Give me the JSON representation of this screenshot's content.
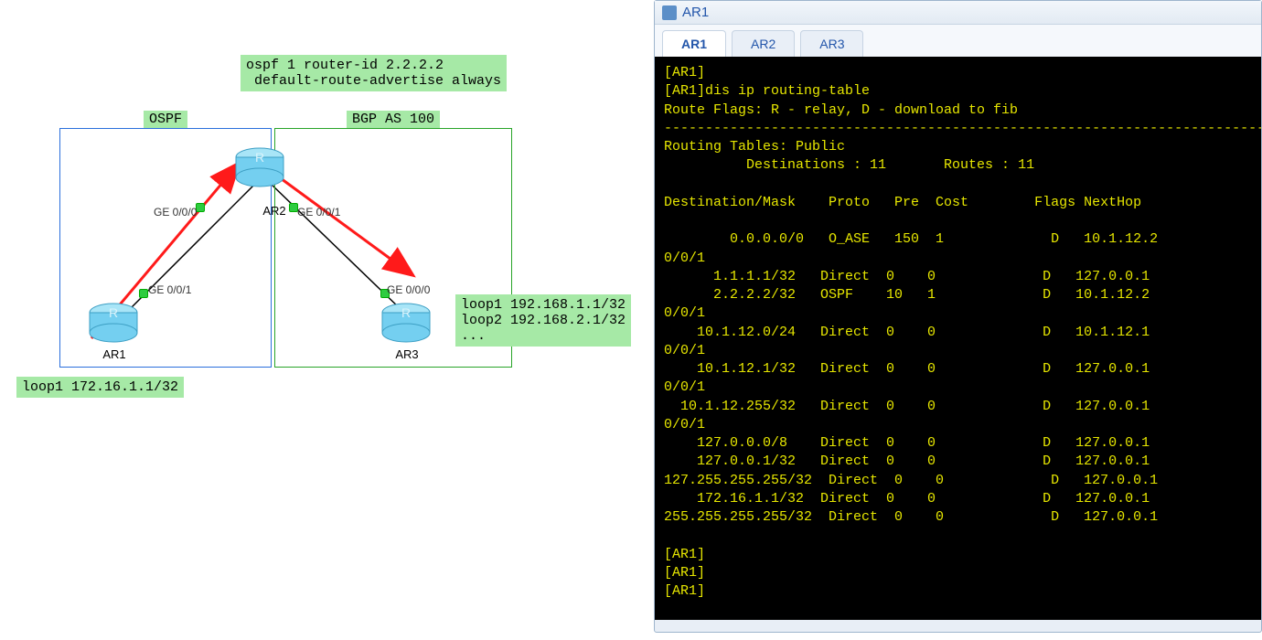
{
  "config_note": "ospf 1 router-id 2.2.2.2\n default-route-advertise always",
  "areas": {
    "ospf": {
      "label": "OSPF"
    },
    "bgp": {
      "label": "BGP AS 100"
    }
  },
  "routers": {
    "ar1": {
      "name": "AR1"
    },
    "ar2": {
      "name": "AR2"
    },
    "ar3": {
      "name": "AR3"
    }
  },
  "interfaces": {
    "ar1_ge001": "GE 0/0/1",
    "ar2_ge000": "GE 0/0/0",
    "ar2_ge001": "GE 0/0/1",
    "ar3_ge000": "GE 0/0/0"
  },
  "loopbacks": {
    "ar1": "loop1 172.16.1.1/32",
    "ar3": "loop1 192.168.1.1/32\nloop2 192.168.2.1/32\n..."
  },
  "terminal": {
    "title": "AR1",
    "tabs": [
      "AR1",
      "AR2",
      "AR3"
    ],
    "active_tab": 0,
    "prompt1": "[AR1]",
    "cmd_line": "[AR1]dis ip routing-table",
    "flags_line": "Route Flags: R - relay, D - download to fib",
    "rt_header": "Routing Tables: Public",
    "dest_line": "          Destinations : 11       Routes : 11",
    "cols": "Destination/Mask    Proto   Pre  Cost        Flags NextHop",
    "rows": [
      "        0.0.0.0/0   O_ASE   150  1             D   10.1.12.2",
      "0/0/1",
      "      1.1.1.1/32   Direct  0    0             D   127.0.0.1",
      "      2.2.2.2/32   OSPF    10   1             D   10.1.12.2",
      "0/0/1",
      "    10.1.12.0/24   Direct  0    0             D   10.1.12.1",
      "0/0/1",
      "    10.1.12.1/32   Direct  0    0             D   127.0.0.1",
      "0/0/1",
      "  10.1.12.255/32   Direct  0    0             D   127.0.0.1",
      "0/0/1",
      "    127.0.0.0/8    Direct  0    0             D   127.0.0.1",
      "    127.0.0.1/32   Direct  0    0             D   127.0.0.1",
      "127.255.255.255/32  Direct  0    0             D   127.0.0.1",
      "    172.16.1.1/32  Direct  0    0             D   127.0.0.1",
      "255.255.255.255/32  Direct  0    0             D   127.0.0.1"
    ],
    "tail": [
      "",
      "[AR1]",
      "[AR1]",
      "[AR1]"
    ]
  }
}
